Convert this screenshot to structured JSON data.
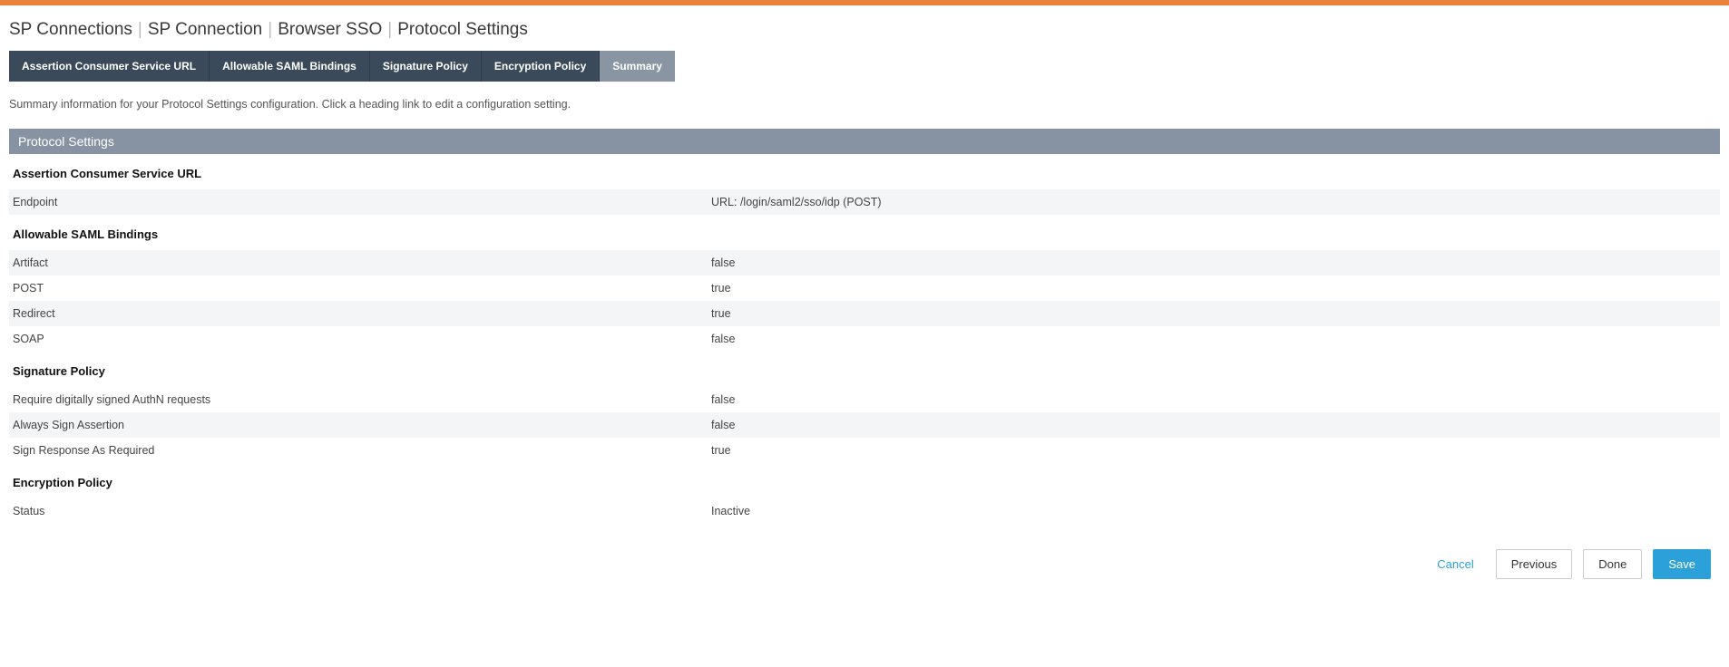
{
  "breadcrumb": [
    "SP Connections",
    "SP Connection",
    "Browser SSO",
    "Protocol Settings"
  ],
  "tabs": [
    {
      "label": "Assertion Consumer Service URL",
      "active": false
    },
    {
      "label": "Allowable SAML Bindings",
      "active": false
    },
    {
      "label": "Signature Policy",
      "active": false
    },
    {
      "label": "Encryption Policy",
      "active": false
    },
    {
      "label": "Summary",
      "active": true
    }
  ],
  "description": "Summary information for your Protocol Settings configuration. Click a heading link to edit a configuration setting.",
  "section_title": "Protocol Settings",
  "groups": [
    {
      "heading": "Assertion Consumer Service URL",
      "rows": [
        {
          "label": "Endpoint",
          "value": "URL: /login/saml2/sso/idp (POST)",
          "shade": true
        }
      ]
    },
    {
      "heading": "Allowable SAML Bindings",
      "rows": [
        {
          "label": "Artifact",
          "value": "false",
          "shade": true
        },
        {
          "label": "POST",
          "value": "true",
          "shade": false
        },
        {
          "label": "Redirect",
          "value": "true",
          "shade": true
        },
        {
          "label": "SOAP",
          "value": "false",
          "shade": false
        }
      ]
    },
    {
      "heading": "Signature Policy",
      "rows": [
        {
          "label": "Require digitally signed AuthN requests",
          "value": "false",
          "shade": false
        },
        {
          "label": "Always Sign Assertion",
          "value": "false",
          "shade": true
        },
        {
          "label": "Sign Response As Required",
          "value": "true",
          "shade": false
        }
      ]
    },
    {
      "heading": "Encryption Policy",
      "rows": [
        {
          "label": "Status",
          "value": "Inactive",
          "shade": false
        }
      ]
    }
  ],
  "actions": {
    "cancel": "Cancel",
    "previous": "Previous",
    "done": "Done",
    "save": "Save"
  }
}
